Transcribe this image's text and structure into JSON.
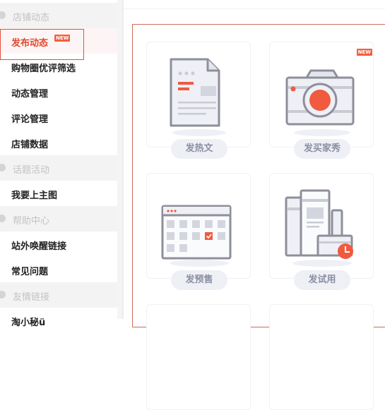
{
  "sidebar": {
    "groups": [
      {
        "label": "店铺动态"
      },
      {
        "label": "话题活动"
      },
      {
        "label": "帮助中心"
      },
      {
        "label": "友情链接"
      }
    ],
    "items": [
      {
        "label": "发布动态",
        "badge": "NEW",
        "active": true
      },
      {
        "label": "购物圈优评筛选"
      },
      {
        "label": "动态管理"
      },
      {
        "label": "评论管理"
      },
      {
        "label": "店铺数据"
      },
      {
        "label": "我要上主图"
      },
      {
        "label": "站外唤醒链接"
      },
      {
        "label": "常见问题"
      },
      {
        "label": "淘小秘ü"
      }
    ]
  },
  "cards": [
    {
      "label": "发热文",
      "icon": "document-icon"
    },
    {
      "label": "发买家秀",
      "icon": "camera-icon",
      "badge": "NEW"
    },
    {
      "label": "发预售",
      "icon": "calendar-icon"
    },
    {
      "label": "发试用",
      "icon": "products-clock-icon"
    }
  ],
  "colors": {
    "accent": "#f05a3e",
    "icon_stroke": "#8e8f9a",
    "pill_bg": "#eef0f6",
    "border_active": "#e0503a"
  }
}
